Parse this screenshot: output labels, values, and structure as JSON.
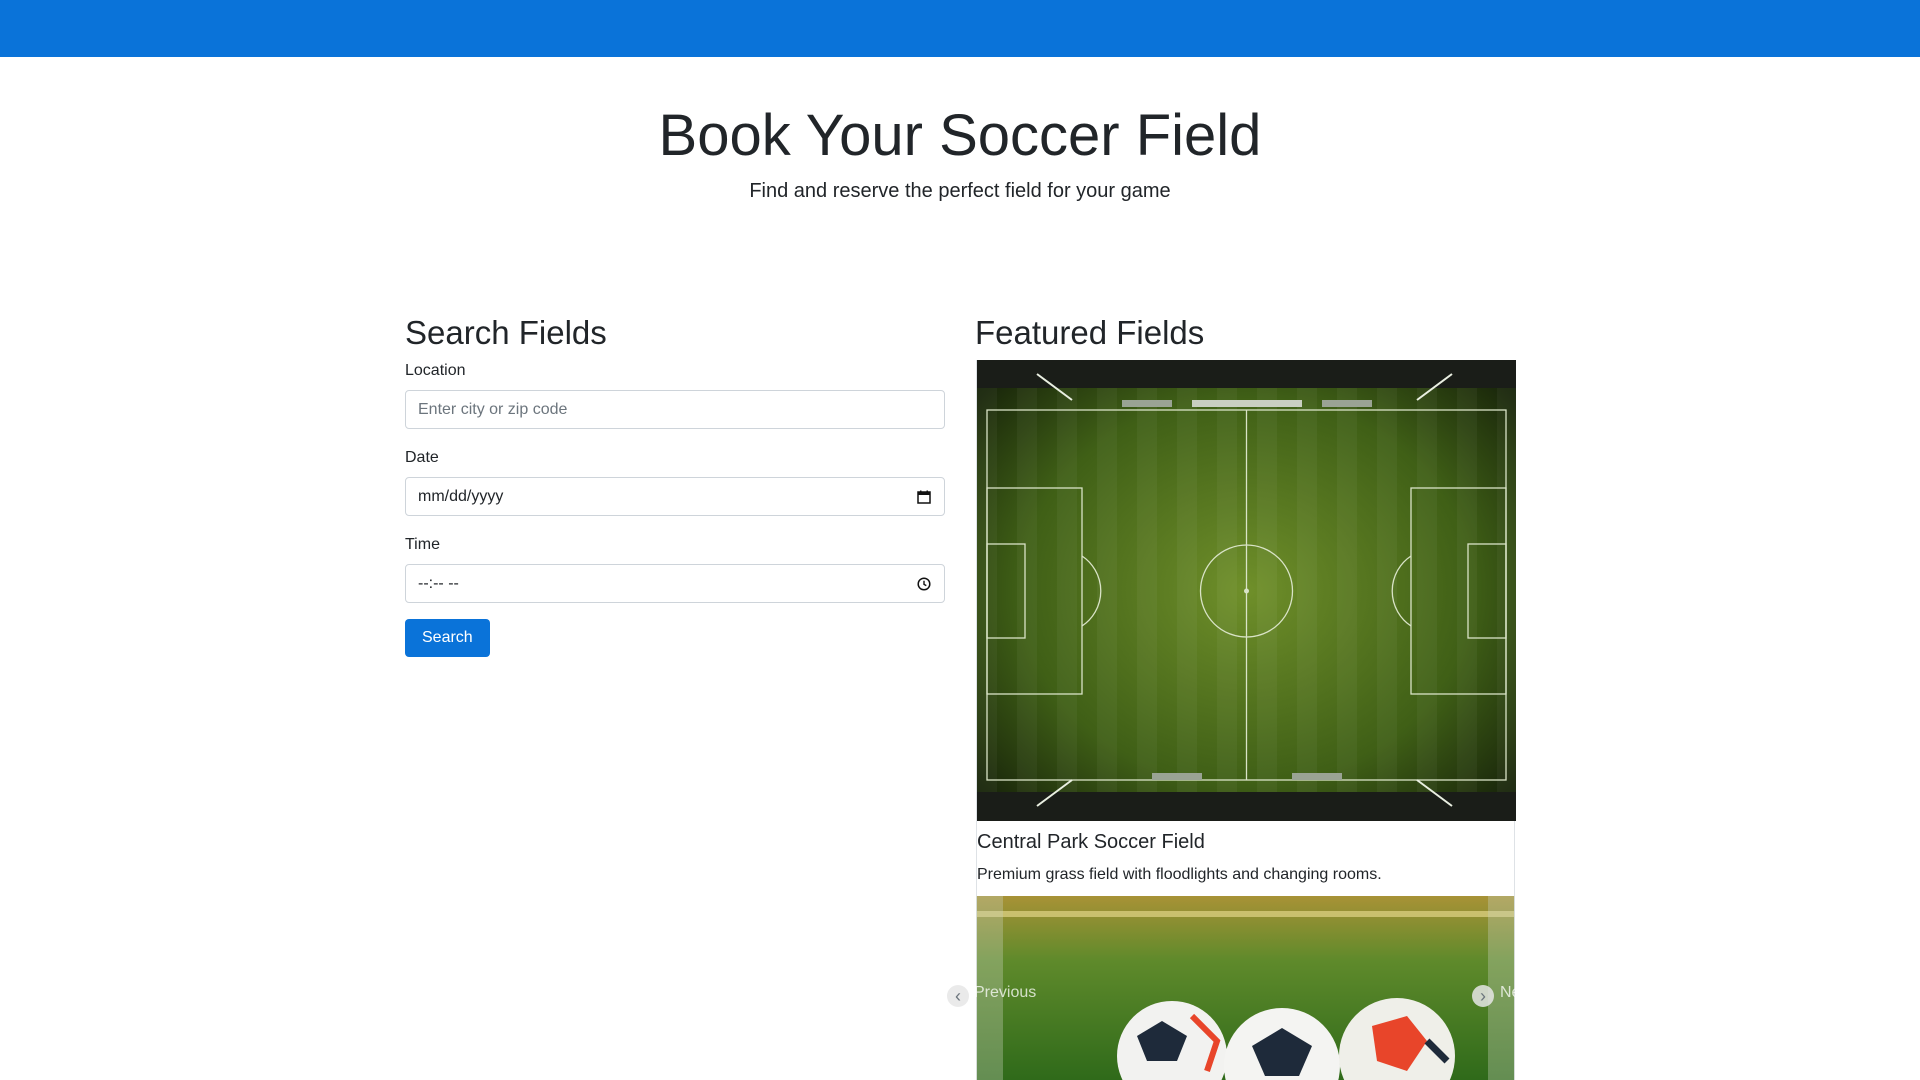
{
  "hero": {
    "title": "Book Your Soccer Field",
    "subtitle": "Find and reserve the perfect field for your game"
  },
  "search": {
    "title": "Search Fields",
    "location_label": "Location",
    "location_placeholder": "Enter city or zip code",
    "date_label": "Date",
    "date_placeholder": "mm/dd/yyyy",
    "time_label": "Time",
    "time_placeholder": "--:-- --",
    "button_label": "Search"
  },
  "featured": {
    "title": "Featured Fields",
    "cards": [
      {
        "name": "Central Park Soccer Field",
        "description": "Premium grass field with floodlights and changing rooms."
      }
    ],
    "prev_label": "Previous",
    "next_label": "Next"
  },
  "colors": {
    "brand": "#0a73d9"
  }
}
